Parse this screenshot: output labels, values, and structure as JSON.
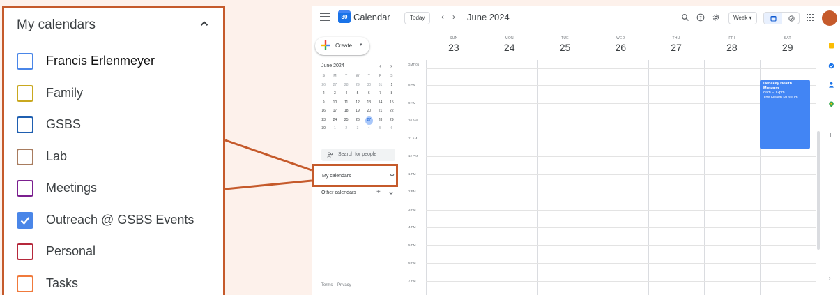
{
  "zoom": {
    "title": "My calendars",
    "calendars": [
      {
        "label": "Francis Erlenmeyer",
        "color": "#4a86e8",
        "checked": false
      },
      {
        "label": "Family",
        "color": "#c9a81f",
        "checked": false
      },
      {
        "label": "GSBS",
        "color": "#1f5fb0",
        "checked": false
      },
      {
        "label": "Lab",
        "color": "#a87c5f",
        "checked": false
      },
      {
        "label": "Meetings",
        "color": "#7b1f8f",
        "checked": false
      },
      {
        "label": "Outreach @ GSBS Events",
        "color": "#4a86e8",
        "checked": true
      },
      {
        "label": "Personal",
        "color": "#b5283b",
        "checked": false
      },
      {
        "label": "Tasks",
        "color": "#f07a3c",
        "checked": false
      }
    ]
  },
  "app": {
    "name": "Calendar",
    "logo_text": "30",
    "today": "Today",
    "prev": "‹",
    "next": "›",
    "month_title": "June 2024",
    "view": "Week ▾"
  },
  "sidebar": {
    "create": "Create",
    "create_caret": "▾",
    "mini_month": "June 2024",
    "mini_prev": "‹",
    "mini_next": "›",
    "dow": [
      "S",
      "M",
      "T",
      "W",
      "T",
      "F",
      "S"
    ],
    "weeks": [
      [
        "26",
        "27",
        "28",
        "29",
        "30",
        "31",
        "1"
      ],
      [
        "2",
        "3",
        "4",
        "5",
        "6",
        "7",
        "8"
      ],
      [
        "9",
        "10",
        "11",
        "12",
        "13",
        "14",
        "15"
      ],
      [
        "16",
        "17",
        "18",
        "19",
        "20",
        "21",
        "22"
      ],
      [
        "23",
        "24",
        "25",
        "26",
        "27",
        "28",
        "29"
      ],
      [
        "30",
        "1",
        "2",
        "3",
        "4",
        "5",
        "6"
      ]
    ],
    "search_people": "Search for people",
    "my_calendars": "My calendars",
    "other_calendars": "Other calendars",
    "other_plus": "+",
    "terms": "Terms – Privacy"
  },
  "week": {
    "timezone": "GMT-05",
    "days": [
      {
        "dow": "SUN",
        "num": "23"
      },
      {
        "dow": "MON",
        "num": "24"
      },
      {
        "dow": "TUE",
        "num": "25"
      },
      {
        "dow": "WED",
        "num": "26"
      },
      {
        "dow": "THU",
        "num": "27"
      },
      {
        "dow": "FRI",
        "num": "28"
      },
      {
        "dow": "SAT",
        "num": "29"
      }
    ],
    "hours": [
      "8 AM",
      "9 AM",
      "10 AM",
      "11 AM",
      "12 PM",
      "1 PM",
      "2 PM",
      "3 PM",
      "4 PM",
      "5 PM",
      "6 PM",
      "7 PM"
    ],
    "event": {
      "title": "Debakey Health Museum",
      "time": "8am – 12pm",
      "location": "The Health Museum",
      "color": "#4285f4"
    }
  },
  "side_panel": {
    "plus": "+",
    "more": "›"
  },
  "colors": {
    "accent": "#c55a2b",
    "background": "#fdf1eb"
  }
}
